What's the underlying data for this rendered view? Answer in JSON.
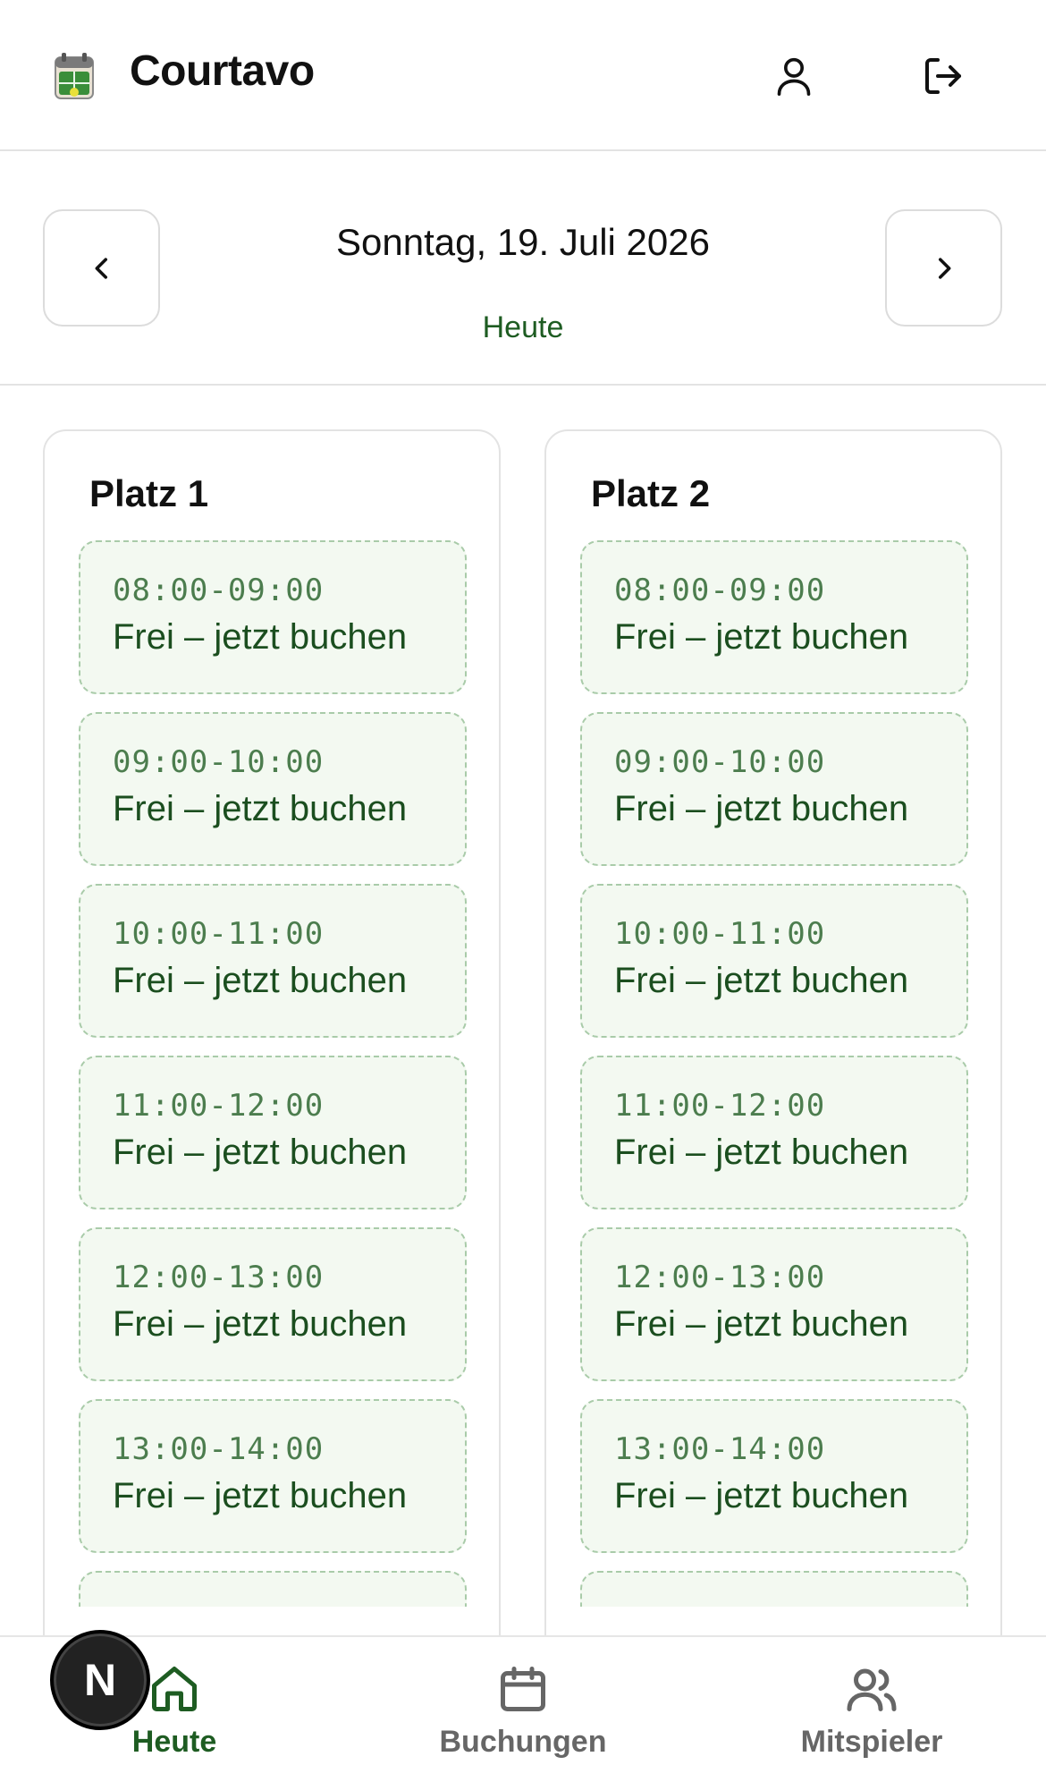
{
  "header": {
    "brand": "Courtavo",
    "logo_icon": "court-calendar-logo",
    "user_icon": "user-icon",
    "logout_icon": "logout-icon"
  },
  "datenav": {
    "date": "Sonntag, 19. Juli 2026",
    "today_label": "Heute",
    "prev_icon": "chevron-left-icon",
    "next_icon": "chevron-right-icon"
  },
  "courts": [
    {
      "name": "Platz 1",
      "slots": [
        {
          "time": "08:00-09:00",
          "status": "Frei – jetzt buchen"
        },
        {
          "time": "09:00-10:00",
          "status": "Frei – jetzt buchen"
        },
        {
          "time": "10:00-11:00",
          "status": "Frei – jetzt buchen"
        },
        {
          "time": "11:00-12:00",
          "status": "Frei – jetzt buchen"
        },
        {
          "time": "12:00-13:00",
          "status": "Frei – jetzt buchen"
        },
        {
          "time": "13:00-14:00",
          "status": "Frei – jetzt buchen"
        }
      ]
    },
    {
      "name": "Platz 2",
      "slots": [
        {
          "time": "08:00-09:00",
          "status": "Frei – jetzt buchen"
        },
        {
          "time": "09:00-10:00",
          "status": "Frei – jetzt buchen"
        },
        {
          "time": "10:00-11:00",
          "status": "Frei – jetzt buchen"
        },
        {
          "time": "11:00-12:00",
          "status": "Frei – jetzt buchen"
        },
        {
          "time": "12:00-13:00",
          "status": "Frei – jetzt buchen"
        },
        {
          "time": "13:00-14:00",
          "status": "Frei – jetzt buchen"
        }
      ]
    }
  ],
  "bottomnav": {
    "items": [
      {
        "label": "Heute",
        "icon": "home-icon",
        "active": true
      },
      {
        "label": "Buchungen",
        "icon": "calendar-icon",
        "active": false
      },
      {
        "label": "Mitspieler",
        "icon": "users-icon",
        "active": false
      }
    ]
  },
  "dev_badge": {
    "letter": "N"
  },
  "colors": {
    "accent": "#1e5c22",
    "slot_bg": "#f3f9f1",
    "slot_border": "#a9cba9",
    "border": "#e3e3e3"
  }
}
